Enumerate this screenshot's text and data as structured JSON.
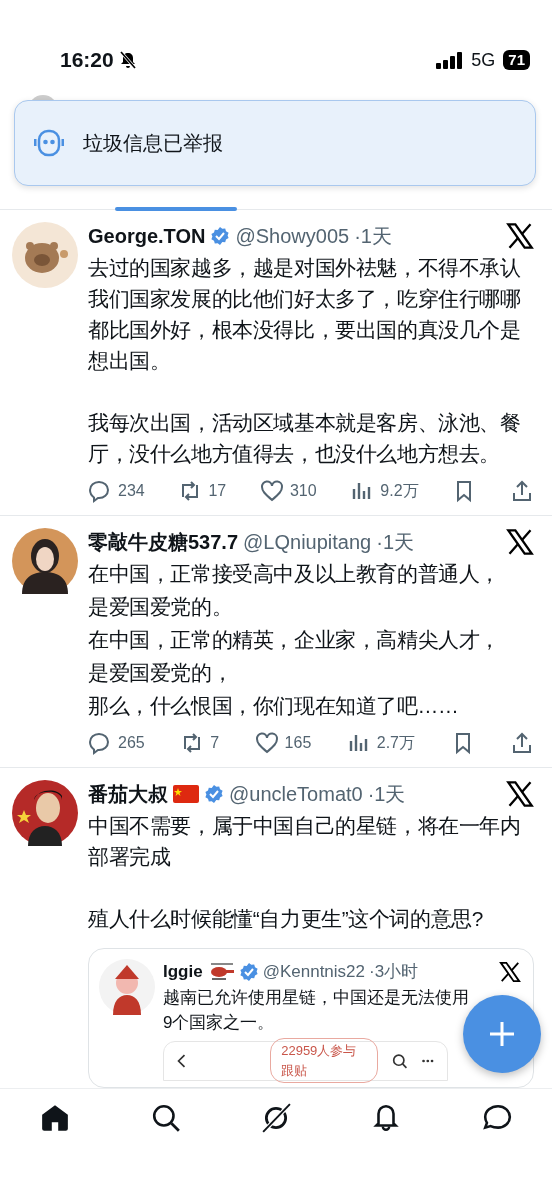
{
  "status_bar": {
    "time": "16:20",
    "network": "5G",
    "battery": "71"
  },
  "toast": {
    "text": "垃圾信息已举报"
  },
  "posts": [
    {
      "name": "George.TON",
      "verified": true,
      "handle": "@Showy005",
      "time": "·1天",
      "paragraphs": [
        "去过的国家越多，越是对国外祛魅，不得不承认我们国家发展的比他们好太多了，吃穿住行哪哪都比国外好，根本没得比，要出国的真没几个是想出国。",
        "我每次出国，活动区域基本就是客房、泳池、餐厅，没什么地方值得去，也没什么地方想去。"
      ],
      "stats": {
        "replies": "234",
        "reposts": "17",
        "likes": "310",
        "views": "9.2万"
      }
    },
    {
      "name": "零敲牛皮糖537.7",
      "verified": false,
      "handle": "@LQniupitang",
      "time": "·1天",
      "lines": [
        "在中国，正常接受高中及以上教育的普通人，",
        "是爱国爱党的。",
        "在中国，正常的精英，企业家，高精尖人才，",
        "是爱国爱党的，",
        "那么，什么恨国，你们现在知道了吧……"
      ],
      "stats": {
        "replies": "265",
        "reposts": "7",
        "likes": "165",
        "views": "2.7万"
      }
    },
    {
      "name": "番茄大叔",
      "name_icon": {
        "kind": "flag"
      },
      "verified": true,
      "handle": "@uncleTomat0",
      "time": "·1天",
      "paragraphs": [
        "中国不需要，属于中国自己的星链，将在一年内部署完成",
        "殖人什么时候能懂“自力更生”这个词的意思?"
      ],
      "quote": {
        "name": "Iggie",
        "name_icon": {
          "kind": "helicopter"
        },
        "verified": true,
        "handle": "@Kenntnis22",
        "time": "·3小时",
        "lines": [
          "越南已允许使用星链，中国还是无法使用",
          "9个国家之一。"
        ],
        "embed": {
          "pill": "22959人参与跟贴"
        }
      }
    }
  ],
  "nav": [
    {
      "kind": "home",
      "selected": true
    },
    {
      "kind": "search",
      "selected": false
    },
    {
      "kind": "grok",
      "selected": false
    },
    {
      "kind": "bell",
      "selected": false
    },
    {
      "kind": "chat",
      "selected": false
    }
  ]
}
